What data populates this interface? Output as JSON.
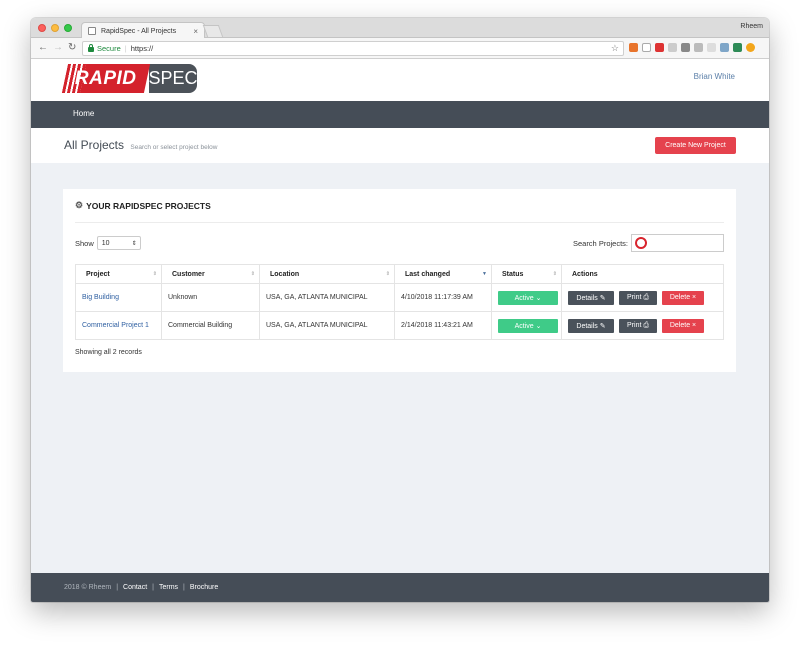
{
  "browser": {
    "tab_title": "RapidSpec - All Projects",
    "tab_close": "×",
    "profile": "Rheem",
    "secure_label": "Secure",
    "url": "https://"
  },
  "header": {
    "logo_left": "RAPID",
    "logo_right": "SPEC",
    "user": "Brian White"
  },
  "nav": {
    "home": "Home"
  },
  "titlebar": {
    "title": "All Projects",
    "subtitle": "Search or select project below",
    "create_button": "Create New Project"
  },
  "panel": {
    "heading": "YOUR RAPIDSPEC PROJECTS",
    "show_label": "Show",
    "show_value": "10",
    "search_label": "Search Projects:",
    "records": "Showing all 2 records"
  },
  "table": {
    "headers": [
      "Project",
      "Customer",
      "Location",
      "Last changed",
      "Status",
      "Actions"
    ],
    "rows": [
      {
        "project": "Big Building",
        "customer": "Unknown",
        "location": "USA, GA, ATLANTA MUNICIPAL",
        "last_changed": "4/10/2018 11:17:39 AM",
        "status": "Active ⌄"
      },
      {
        "project": "Commercial Project 1",
        "customer": "Commercial Building",
        "location": "USA, GA, ATLANTA MUNICIPAL",
        "last_changed": "2/14/2018 11:43:21 AM",
        "status": "Active ⌄"
      }
    ],
    "action_labels": {
      "details": "Details ✎",
      "print": "Print ⎙",
      "delete": "Delete ×"
    }
  },
  "footer": {
    "copyright": "2018 © Rheem",
    "links": [
      "Contact",
      "Terms",
      "Brochure"
    ]
  },
  "colors": {
    "brand_red": "#d4222c",
    "nav_dark": "#454d57",
    "status_green": "#3fcb88",
    "delete_red": "#e5424d"
  }
}
